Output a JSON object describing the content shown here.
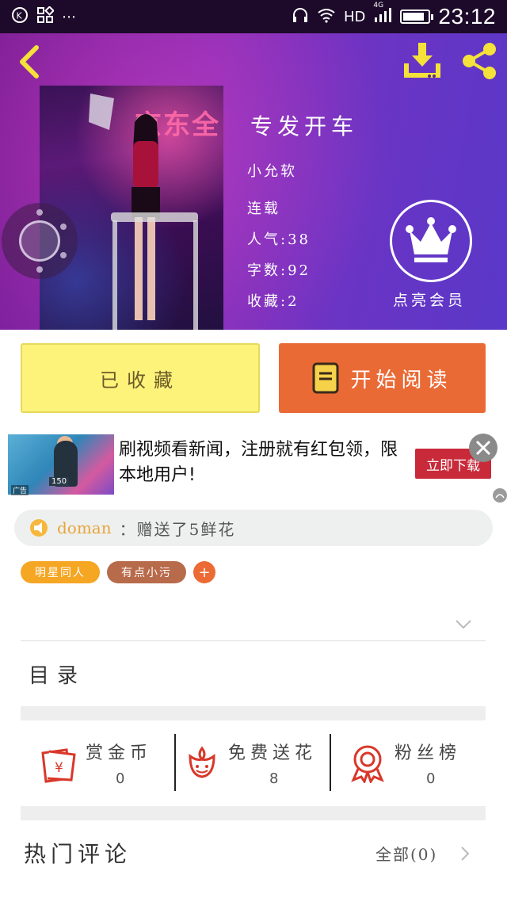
{
  "statusbar": {
    "network": "HD",
    "signal_label": "4G",
    "time": "23:12",
    "battery_level": 0.85
  },
  "book": {
    "title": "专发开车",
    "author": "小允软",
    "status": "连载",
    "popularity": "人气:38",
    "word_count": "字数:92",
    "favorites": "收藏:2",
    "cover_sign": "京东全"
  },
  "vip": {
    "label": "点亮会员"
  },
  "actions": {
    "favorited_label": "已收藏",
    "read_label": "开始阅读"
  },
  "ad": {
    "text": "刷视频看新闻，注册就有红包领，限本地用户!",
    "cta": "立即下载",
    "thumb_tag": "150",
    "thumb_mark": "广告"
  },
  "gift": {
    "user": "doman",
    "text": "：赠送了5鲜花"
  },
  "tags": [
    {
      "label": "明星同人",
      "color": "#f5a623"
    },
    {
      "label": "有点小污",
      "color": "#b86b4b"
    }
  ],
  "tag_add_label": "+",
  "toc_label": "目录",
  "stats": [
    {
      "label": "赏金币",
      "value": "0",
      "icon": "red-envelope-icon",
      "color": "#d8382a"
    },
    {
      "label": "免费送花",
      "value": "8",
      "icon": "flower-icon",
      "color": "#d8382a"
    },
    {
      "label": "粉丝榜",
      "value": "0",
      "icon": "medal-icon",
      "color": "#d8382a"
    }
  ],
  "comments": {
    "title": "热门评论",
    "all_label": "全部(0)"
  },
  "colors": {
    "accent_yellow": "#fdf27a",
    "accent_orange": "#ea6a35",
    "icon_yellow": "#f4e23a",
    "hero_purple": "#7a1d96"
  }
}
